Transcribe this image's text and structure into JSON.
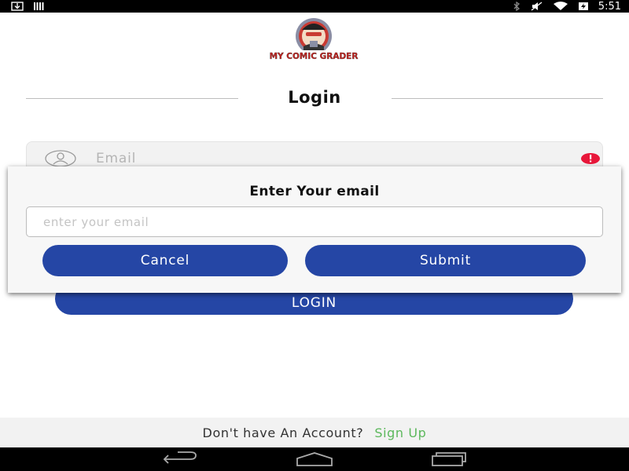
{
  "status_bar": {
    "time": "5:51",
    "icons": [
      "download-icon",
      "barcode-icon",
      "bluetooth-icon",
      "mute-icon",
      "wifi-icon",
      "battery-charging-icon"
    ]
  },
  "logo": {
    "text": "MY COMIC GRADER"
  },
  "login": {
    "title": "Login",
    "email_placeholder": "Email",
    "button_label": "LOGIN"
  },
  "dialog": {
    "title": "Enter Your email",
    "input_placeholder": "enter your email",
    "input_value": "",
    "cancel_label": "Cancel",
    "submit_label": "Submit"
  },
  "footer": {
    "question": "Don't have An Account?",
    "signup_label": "Sign Up"
  },
  "colors": {
    "primary": "#2546a5",
    "signup_green": "#5cb85c",
    "error_red": "#e8173a"
  }
}
